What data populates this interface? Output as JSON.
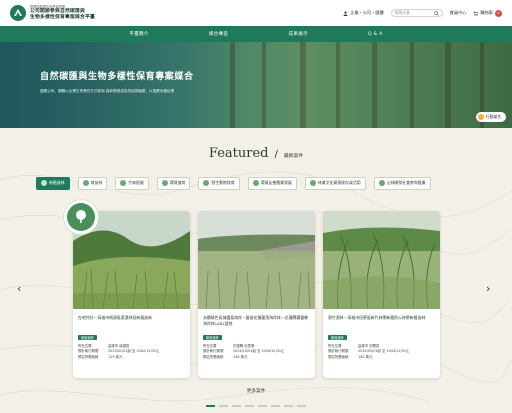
{
  "header": {
    "logo_small": "農業部林業及自然保育署",
    "logo_line1": "公司開辦參與自然碳匯與",
    "logo_line2": "生物多樣性保育專案媒合平臺",
    "user_link": "企業・公司・團體",
    "search_placeholder": "搜尋文章",
    "member_link": "會員中心",
    "cart_label": "購物車",
    "cart_count": "0"
  },
  "nav": {
    "items": [
      "平臺簡介",
      "媒合專區",
      "成果展示",
      "Q & A"
    ]
  },
  "hero": {
    "title": "自然碳匯與生物多樣性保育專案媒合",
    "subtitle": "鼓勵公司、團體以企業社會責任方式參與 森林經營或自然保育議題，以落實永續目標",
    "tag": "行動媒合"
  },
  "featured": {
    "title": "Featured",
    "subtitle": "最新案件"
  },
  "categories": [
    {
      "label": "新植造林",
      "active": true
    },
    {
      "label": "育苗林",
      "active": false
    },
    {
      "label": "竹林經營",
      "active": false
    },
    {
      "label": "環境復育",
      "active": false
    },
    {
      "label": "野生動物保育",
      "active": false
    },
    {
      "label": "環境友善農業發展",
      "active": false
    },
    {
      "label": "林業文化資源保存或活用",
      "active": false
    },
    {
      "label": "山林開發社會參與推廣",
      "active": false
    }
  ],
  "cards": [
    {
      "title": "在地共好－高雄市桃源區荖濃林班新植造林",
      "badge": "新植造林",
      "meta": [
        [
          "所在位置",
          "高雄市 桃源區"
        ],
        [
          "預計執行期間",
          "2023/01/01起 至 2042/12/31止"
        ],
        [
          "預估所需面積",
          "129 萬元"
        ]
      ]
    },
    {
      "title": "永續綠色長城護島海岸－營造花蓮豐濱海岸林－花蓮縣壽豐鄉海岸林1061號地",
      "badge": "新植造林",
      "meta": [
        [
          "所在位置",
          "花蓮縣 壽豐鄉"
        ],
        [
          "預計執行期間",
          "2024/10/01起 至 2044/12/31止"
        ],
        [
          "預估所需面積",
          "146 萬元"
        ]
      ]
    },
    {
      "title": "適竹適林－高雄市田寮區新竹林帶新植防火林帶新植造林",
      "badge": "新植造林",
      "meta": [
        [
          "所在位置",
          "高雄市 田寮區"
        ],
        [
          "預計執行期間",
          "2024/05/01起 至 2043/12/31止"
        ],
        [
          "預估所需面積",
          "145 萬元"
        ]
      ]
    }
  ],
  "more_label": "更多案件",
  "colors": {
    "primary": "#1f7a5c",
    "background": "#f3f1e7",
    "accent": "#f2b52b"
  }
}
